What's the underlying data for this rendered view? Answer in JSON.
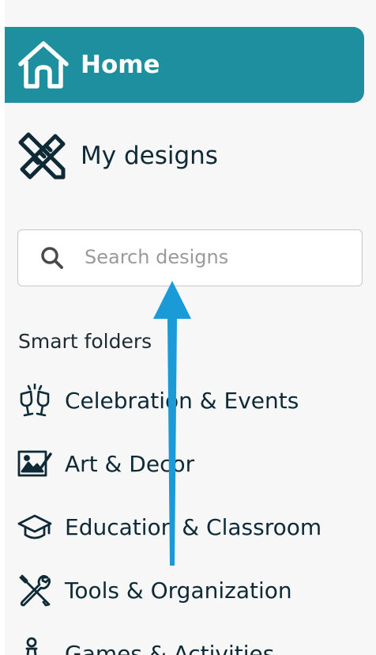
{
  "nav": {
    "home": {
      "label": "Home",
      "icon": "home-icon"
    },
    "designs": {
      "label": "My designs",
      "icon": "pencil-ruler-icon"
    }
  },
  "search": {
    "placeholder": "Search designs",
    "value": "",
    "icon": "search-icon"
  },
  "smart_folders": {
    "title": "Smart folders",
    "items": [
      {
        "label": "Celebration & Events",
        "icon": "champagne-glasses-icon"
      },
      {
        "label": "Art & Decor",
        "icon": "picture-frame-icon"
      },
      {
        "label": "Education & Classroom",
        "icon": "graduation-cap-icon"
      },
      {
        "label": "Tools & Organization",
        "icon": "wrench-screwdriver-icon"
      },
      {
        "label": "Games & Activities",
        "icon": "game-piece-icon"
      }
    ]
  },
  "colors": {
    "accent": "#1d8f9e",
    "text": "#0e2a36",
    "annotation_arrow": "#1a9ad6"
  }
}
